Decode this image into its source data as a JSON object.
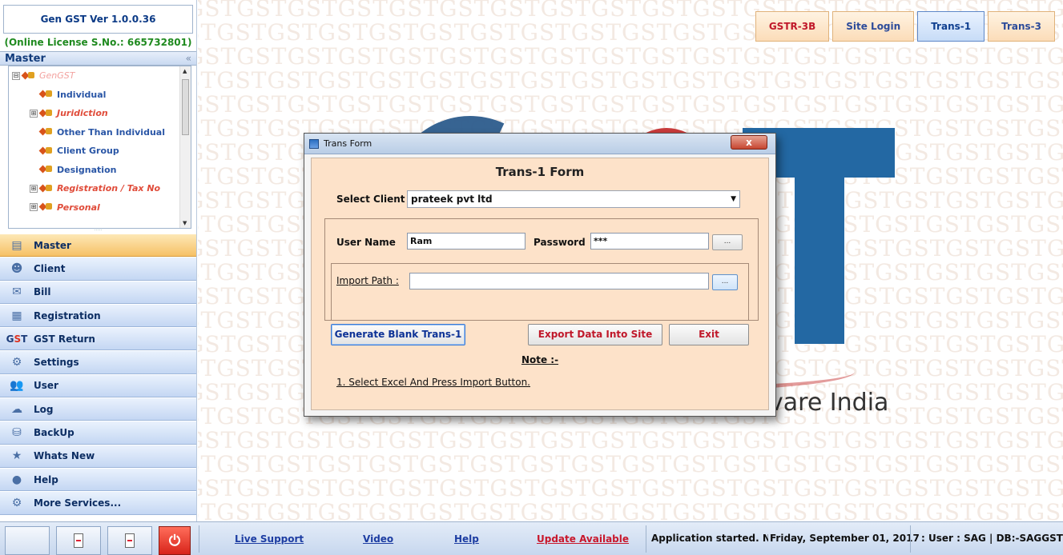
{
  "app": {
    "title": "Gen GST  Ver 1.0.0.36",
    "license": "(Online License S.No.: 665732801)"
  },
  "master_panel": {
    "header": "Master",
    "collapse": "«",
    "tree": [
      {
        "label": "GenGST",
        "style": "root",
        "toggle": "⊟"
      },
      {
        "label": "Individual",
        "style": "normal",
        "toggle": ""
      },
      {
        "label": "Juridiction",
        "style": "italic",
        "toggle": "⊞"
      },
      {
        "label": "Other Than Individual",
        "style": "normal",
        "toggle": ""
      },
      {
        "label": "Client Group",
        "style": "normal",
        "toggle": ""
      },
      {
        "label": "Designation",
        "style": "normal",
        "toggle": ""
      },
      {
        "label": "Registration / Tax No",
        "style": "italic",
        "toggle": "⊞"
      },
      {
        "label": "Personal",
        "style": "italic",
        "toggle": "⊞"
      }
    ]
  },
  "nav": [
    {
      "label": "Master",
      "icon": "master-icon",
      "active": true
    },
    {
      "label": "Client",
      "icon": "client-icon"
    },
    {
      "label": "Bill",
      "icon": "bill-icon"
    },
    {
      "label": "Registration",
      "icon": "registration-icon"
    },
    {
      "label": "GST Return",
      "icon": "gst-icon"
    },
    {
      "label": "Settings",
      "icon": "settings-icon"
    },
    {
      "label": "User",
      "icon": "user-icon"
    },
    {
      "label": "Log",
      "icon": "log-icon"
    },
    {
      "label": "BackUp",
      "icon": "backup-icon"
    },
    {
      "label": "Whats New",
      "icon": "new-icon"
    },
    {
      "label": "Help",
      "icon": "help-icon"
    },
    {
      "label": "More Services...",
      "icon": "more-services-icon"
    }
  ],
  "background": {
    "watermark": "GSTGSTGSTGSTGSTGSTGSTGSTGSTGSTGSTGSTGSTGSTGSTGSTGSTGSTGST",
    "caption": "vare India"
  },
  "top_tabs": [
    {
      "label": "GSTR-3B",
      "style": "red"
    },
    {
      "label": "Site Login",
      "style": "normal"
    },
    {
      "label": "Trans-1",
      "style": "active"
    },
    {
      "label": "Trans-3",
      "style": "normal"
    }
  ],
  "modal": {
    "window_title": "Trans Form",
    "close": "x",
    "form_title": "Trans-1 Form",
    "select_client_label": "Select Client",
    "select_client_value": "prateek pvt ltd",
    "username_label": "User Name",
    "username_value": "Ram",
    "password_label": "Password",
    "password_value": "***",
    "browse": "...",
    "import_path_label": "Import Path :",
    "import_path_value": "",
    "generate_button": "Generate Blank Trans-1",
    "export_button": "Export Data Into Site",
    "exit_button": "Exit",
    "note_label": "Note :-",
    "note_line": "1. Select Excel And Press Import Button."
  },
  "status_bar": {
    "live_support": "Live Support",
    "video": "Video",
    "help": "Help",
    "update": "Update Available",
    "message": "Application started. No a",
    "date": "Friday, September 01, 2017",
    "user_db": ": User : SAG | DB:-SAGGST"
  },
  "colors": {
    "accent_blue": "#1d3da2",
    "accent_red": "#c0182a",
    "form_bg": "#fde2c9",
    "nav_active": "#f6c165"
  }
}
